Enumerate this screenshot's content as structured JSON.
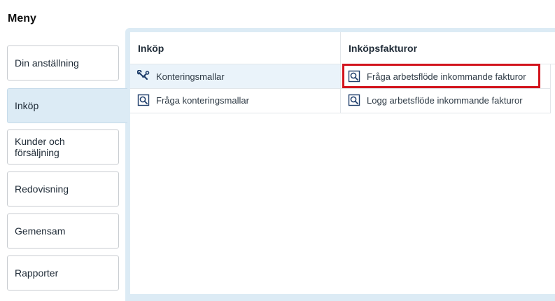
{
  "sidebar": {
    "title": "Meny",
    "items": [
      {
        "label": "Din anställning"
      },
      {
        "label": "Inköp"
      },
      {
        "label": "Kunder och försäljning"
      },
      {
        "label": "Redovisning"
      },
      {
        "label": "Gemensam"
      },
      {
        "label": "Rapporter"
      }
    ],
    "active": "Inköp"
  },
  "columns": [
    {
      "header": "Inköp",
      "items": [
        {
          "label": "Konteringsmallar",
          "icon": "tools-icon"
        },
        {
          "label": "Fråga konteringsmallar",
          "icon": "search-document-icon"
        }
      ]
    },
    {
      "header": "Inköpsfakturor",
      "items": [
        {
          "label": "Fråga arbetsflöde inkommande fakturor",
          "icon": "search-document-icon"
        },
        {
          "label": "Logg arbetsflöde inkommande fakturor",
          "icon": "search-document-icon"
        }
      ]
    }
  ],
  "colors": {
    "accent_panel": "#dcebf5",
    "highlight_row": "#eaf3fa",
    "focus_outline": "#d2141d",
    "icon": "#1f3e6b"
  }
}
